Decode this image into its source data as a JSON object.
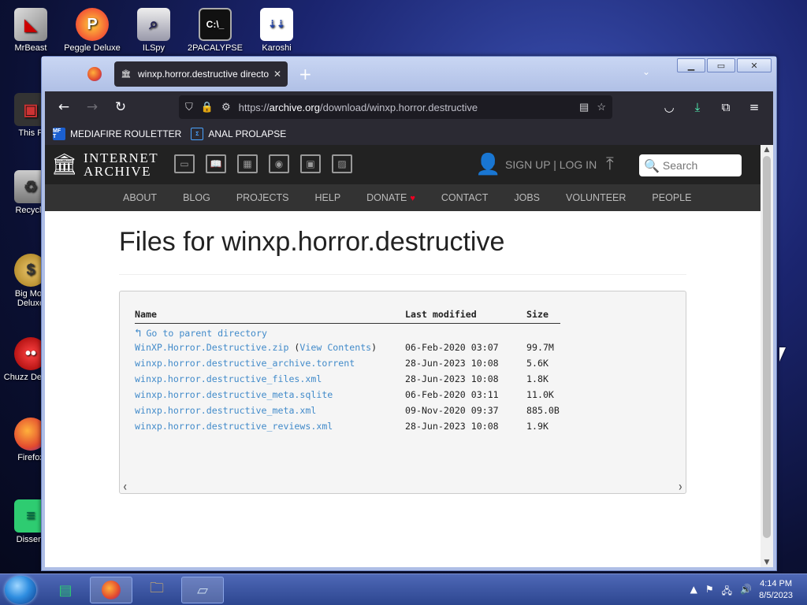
{
  "desktop": {
    "icons": [
      {
        "label": "MrBeast",
        "icon": "mrbeast-icon"
      },
      {
        "label": "Peggle Deluxe",
        "icon": "peggle-icon"
      },
      {
        "label": "ILSpy",
        "icon": "ilspy-icon"
      },
      {
        "label": "2PACALYPSE",
        "icon": "terminal-icon"
      },
      {
        "label": "Karoshi",
        "icon": "karoshi-icon"
      },
      {
        "label": "This P",
        "icon": "computer-icon"
      },
      {
        "label": "Recycle",
        "icon": "recycle-bin-icon"
      },
      {
        "label": "Big Mon Deluxe",
        "icon": "money-bag-icon"
      },
      {
        "label": "Chuzz Deluxe",
        "icon": "chuzzle-icon"
      },
      {
        "label": "Firefox",
        "icon": "firefox-icon"
      },
      {
        "label": "Dissent",
        "icon": "dissent-icon"
      }
    ]
  },
  "browser": {
    "tab_title": "winxp.horror.destructive directory",
    "new_tab": "+",
    "url_prefix": "https://",
    "url_host": "archive.org",
    "url_path": "/download/winxp.horror.destructive",
    "bookmarks": [
      {
        "label": "MEDIAFIRE ROULETTER",
        "badge": "MF T"
      },
      {
        "label": "ANAL PROLAPSE",
        "badge": ""
      }
    ]
  },
  "ia": {
    "logo_line1": "INTERNET",
    "logo_line2": "ARCHIVE",
    "signup": "SIGN UP | LOG IN",
    "search_placeholder": "Search",
    "nav": [
      "ABOUT",
      "BLOG",
      "PROJECTS",
      "HELP",
      "DONATE",
      "CONTACT",
      "JOBS",
      "VOLUNTEER",
      "PEOPLE"
    ]
  },
  "page": {
    "title": "Files for winxp.horror.destructive",
    "columns": [
      "Name",
      "Last modified",
      "Size"
    ],
    "parent_link": "Go to parent directory",
    "files": [
      {
        "name": "WinXP.Horror.Destructive.zip",
        "extra": "View Contents",
        "modified": "06-Feb-2020 03:07",
        "size": "99.7M"
      },
      {
        "name": "winxp.horror.destructive_archive.torrent",
        "extra": "",
        "modified": "28-Jun-2023 10:08",
        "size": "5.6K"
      },
      {
        "name": "winxp.horror.destructive_files.xml",
        "extra": "",
        "modified": "28-Jun-2023 10:08",
        "size": "1.8K"
      },
      {
        "name": "winxp.horror.destructive_meta.sqlite",
        "extra": "",
        "modified": "06-Feb-2020 03:11",
        "size": "11.0K"
      },
      {
        "name": "winxp.horror.destructive_meta.xml",
        "extra": "",
        "modified": "09-Nov-2020 09:37",
        "size": "885.0B"
      },
      {
        "name": "winxp.horror.destructive_reviews.xml",
        "extra": "",
        "modified": "28-Jun-2023 10:08",
        "size": "1.9K"
      }
    ]
  },
  "taskbar": {
    "time": "4:14 PM",
    "date": "8/5/2023"
  },
  "colors": {
    "link": "#428bca",
    "ia_bar": "#222222",
    "browser_chrome": "#2b2a33"
  }
}
